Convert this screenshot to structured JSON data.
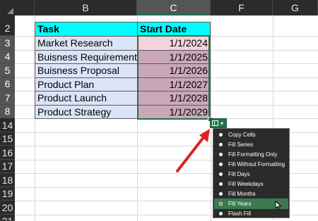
{
  "columns": {
    "b": "B",
    "c": "C",
    "f": "F",
    "g": "G"
  },
  "rows": [
    "2",
    "3",
    "4",
    "5",
    "6",
    "7",
    "8",
    "14",
    "15",
    "16",
    "17",
    "18",
    "19",
    "20",
    "21"
  ],
  "table": {
    "headers": {
      "task": "Task",
      "start": "Start Date"
    },
    "rows": [
      {
        "task": "Market Research",
        "date": "1/1/2024"
      },
      {
        "task": "Buisness Requirements",
        "date": "1/1/2025"
      },
      {
        "task": "Buisness Proposal",
        "date": "1/1/2026"
      },
      {
        "task": "Product Plan",
        "date": "1/1/2027"
      },
      {
        "task": "Product Launch",
        "date": "1/1/2028"
      },
      {
        "task": "Product Strategy",
        "date": "1/1/2029"
      }
    ]
  },
  "menu": {
    "items": [
      "Copy Cells",
      "Fill Series",
      "Fill Formatting Only",
      "Fill Without Formatting",
      "Fill Days",
      "Fill Weekdays",
      "Fill Months",
      "Fill Years",
      "Flash Fill"
    ],
    "selected": "Fill Years"
  },
  "colors": {
    "header_fill": "#00ffff",
    "task_fill": "#dbe4f7",
    "date_fill_first": "#f6d2dc",
    "date_fill": "#c9a7b9",
    "excel_green": "#217346",
    "arrow": "#e02020"
  },
  "icons": {
    "autofill_options": "auto-fill-options-icon",
    "mouse_cursor": "mouse-pointer-icon",
    "annotation": "red-arrow-icon"
  }
}
